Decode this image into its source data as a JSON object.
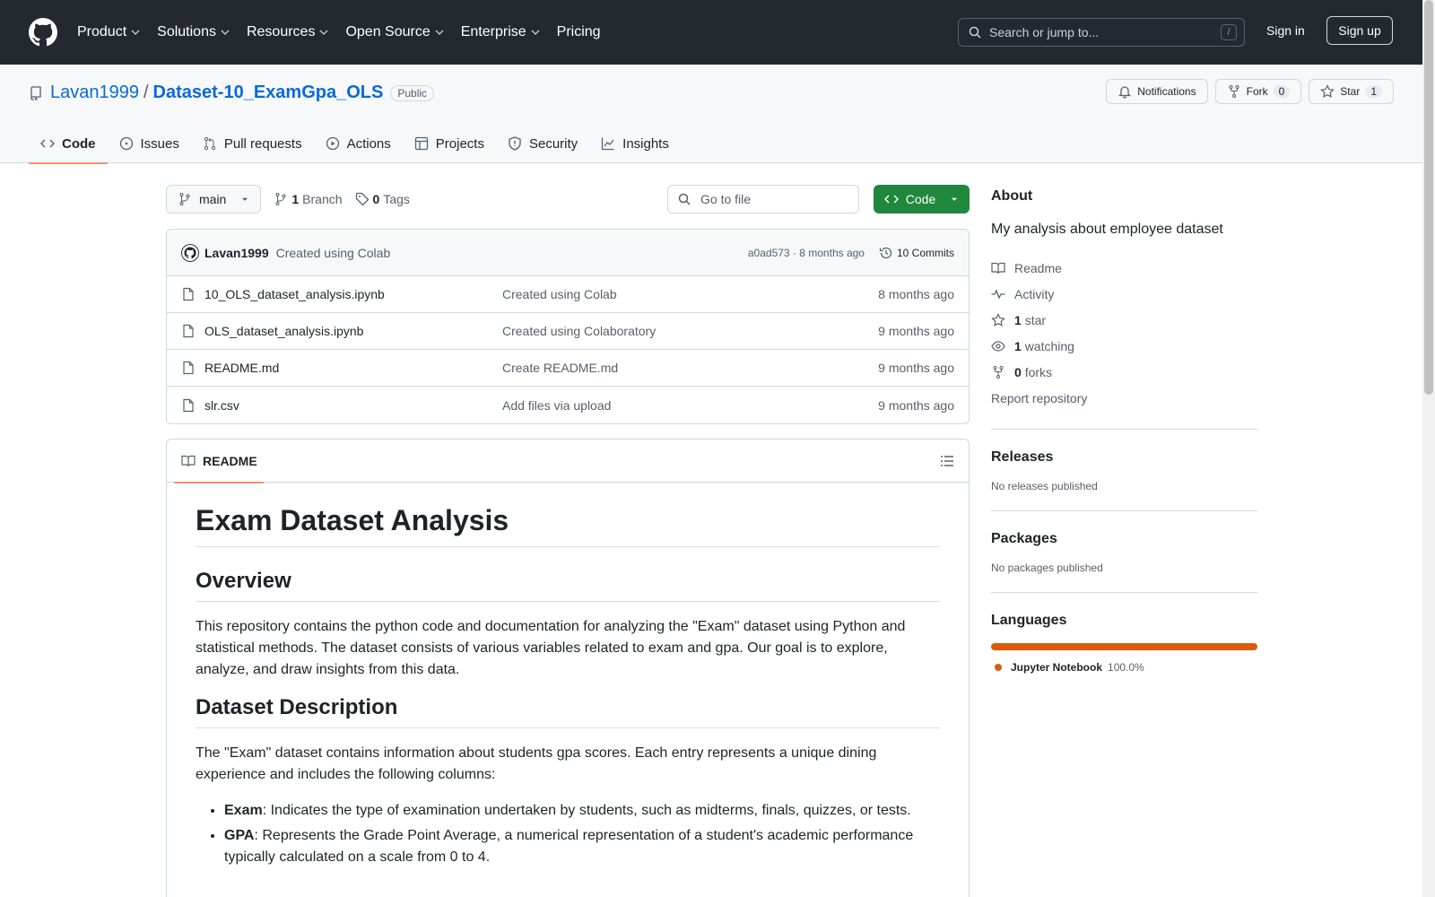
{
  "header": {
    "nav": [
      "Product",
      "Solutions",
      "Resources",
      "Open Source",
      "Enterprise",
      "Pricing"
    ],
    "search_placeholder": "Search or jump to...",
    "search_key": "/",
    "signin": "Sign in",
    "signup": "Sign up"
  },
  "repo": {
    "owner": "Lavan1999",
    "separator": "/",
    "name": "Dataset-10_ExamGpa_OLS",
    "visibility": "Public",
    "notifications": "Notifications",
    "fork": "Fork",
    "fork_count": "0",
    "star": "Star",
    "star_count": "1"
  },
  "tabs": [
    "Code",
    "Issues",
    "Pull requests",
    "Actions",
    "Projects",
    "Security",
    "Insights"
  ],
  "toolbar": {
    "branch": "main",
    "branch_count": "1",
    "branch_label": "Branch",
    "tag_count": "0",
    "tag_label": "Tags",
    "goto_placeholder": "Go to file",
    "code_button": "Code"
  },
  "latest_commit": {
    "author": "Lavan1999",
    "message": "Created using Colab",
    "hash_time": "a0ad573 · 8 months ago",
    "commits": "10 Commits"
  },
  "files": [
    {
      "name": "10_OLS_dataset_analysis.ipynb",
      "message": "Created using Colab",
      "date": "8 months ago"
    },
    {
      "name": "OLS_dataset_analysis.ipynb",
      "message": "Created using Colaboratory",
      "date": "9 months ago"
    },
    {
      "name": "README.md",
      "message": "Create README.md",
      "date": "9 months ago"
    },
    {
      "name": "slr.csv",
      "message": "Add files via upload",
      "date": "9 months ago"
    }
  ],
  "readme": {
    "tab": "README",
    "h1": "Exam Dataset Analysis",
    "overview_h": "Overview",
    "overview_p": "This repository contains the python code and documentation for analyzing the \"Exam\" dataset using Python and statistical methods. The dataset consists of various variables related to exam and gpa. Our goal is to explore, analyze, and draw insights from this data.",
    "desc_h": "Dataset Description",
    "desc_p": "The \"Exam\" dataset contains information about students gpa scores. Each entry represents a unique dining experience and includes the following columns:",
    "items": [
      {
        "term": "Exam",
        "text": ": Indicates the type of examination undertaken by students, such as midterms, finals, quizzes, or tests."
      },
      {
        "term": "GPA",
        "text": ": Represents the Grade Point Average, a numerical representation of a student's academic performance typically calculated on a scale from 0 to 4."
      }
    ]
  },
  "sidebar": {
    "about_h": "About",
    "description": "My analysis about employee dataset",
    "readme": "Readme",
    "activity": "Activity",
    "stars_n": "1",
    "stars": "star",
    "watching_n": "1",
    "watching": "watching",
    "forks_n": "0",
    "forks": "forks",
    "report": "Report repository",
    "releases_h": "Releases",
    "releases_none": "No releases published",
    "packages_h": "Packages",
    "packages_none": "No packages published",
    "languages_h": "Languages",
    "language": "Jupyter Notebook",
    "language_pct": "100.0%",
    "language_color": "#da5b0b"
  }
}
